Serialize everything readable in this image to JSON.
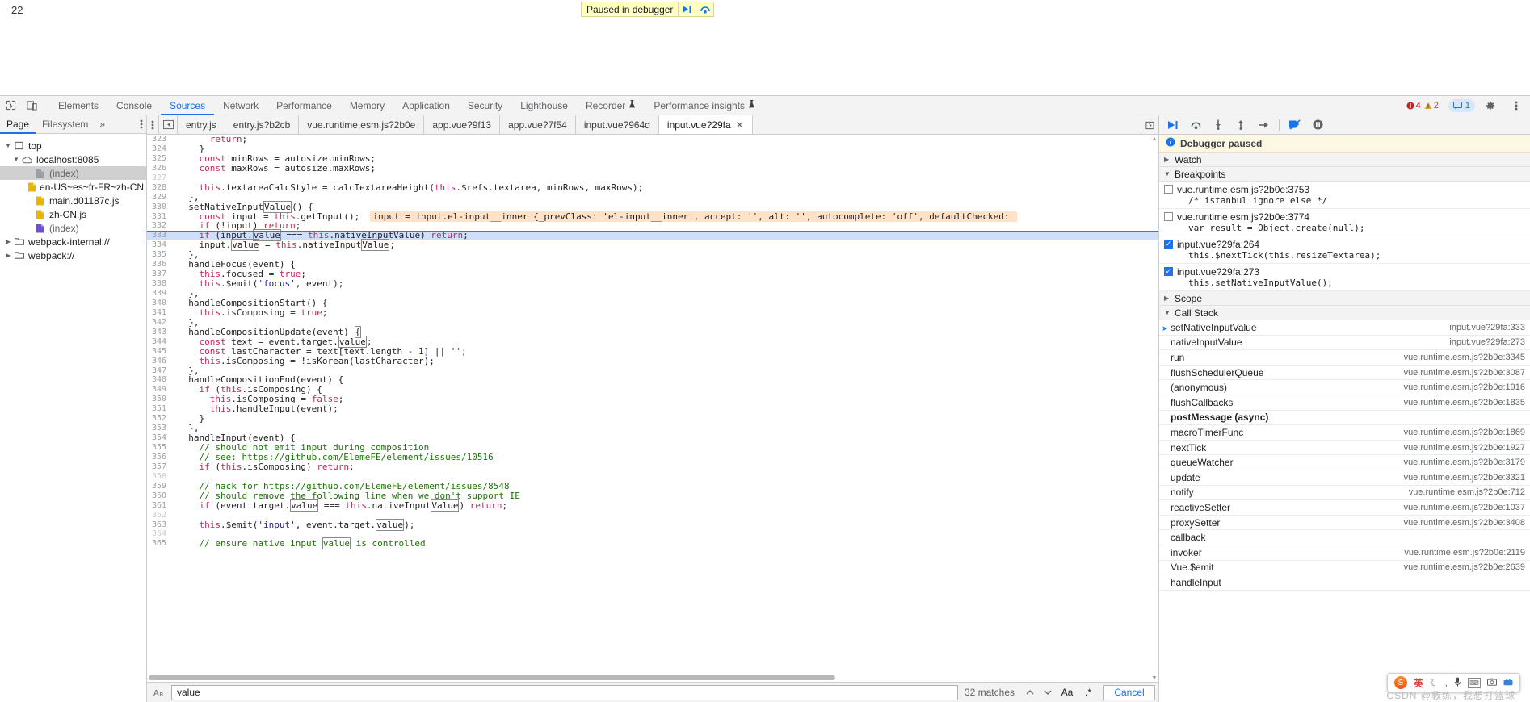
{
  "viewport": {
    "count_label": "22",
    "paused_banner": {
      "text": "Paused in debugger",
      "resume_icon": "resume-icon",
      "step_over_icon": "step-over-icon"
    }
  },
  "devtools": {
    "toolbar": {
      "inspect_icon": "inspect-element-icon",
      "device_toolbar_icon": "device-toolbar-icon",
      "panels": [
        {
          "label": "Elements",
          "active": false,
          "badge": ""
        },
        {
          "label": "Console",
          "active": false,
          "badge": ""
        },
        {
          "label": "Sources",
          "active": true,
          "badge": ""
        },
        {
          "label": "Network",
          "active": false,
          "badge": ""
        },
        {
          "label": "Performance",
          "active": false,
          "badge": ""
        },
        {
          "label": "Memory",
          "active": false,
          "badge": ""
        },
        {
          "label": "Application",
          "active": false,
          "badge": ""
        },
        {
          "label": "Security",
          "active": false,
          "badge": ""
        },
        {
          "label": "Lighthouse",
          "active": false,
          "badge": ""
        },
        {
          "label": "Recorder",
          "active": false,
          "badge": "experiment-icon"
        },
        {
          "label": "Performance insights",
          "active": false,
          "badge": "experiment-icon"
        }
      ],
      "errors_count": "4",
      "warnings_count": "2",
      "messages_count": "1",
      "settings_icon": "gear-icon",
      "more_icon": "kebab-menu-icon"
    },
    "navigator": {
      "tabs": [
        {
          "label": "Page",
          "active": true
        },
        {
          "label": "Filesystem",
          "active": false
        }
      ],
      "more_tabs_icon": "chevron-double-right-icon",
      "kebab_icon": "kebab-menu-icon",
      "tree": [
        {
          "label": "top",
          "depth": 0,
          "icon": "frame-icon",
          "expanded": true,
          "selected": false
        },
        {
          "label": "localhost:8085",
          "depth": 1,
          "icon": "cloud-icon",
          "expanded": true,
          "selected": false
        },
        {
          "label": "(index)",
          "depth": 2,
          "icon": "document-icon",
          "expanded": null,
          "selected": true
        },
        {
          "label": "en-US~es~fr-FR~zh-CN.js",
          "depth": 2,
          "icon": "script-icon",
          "expanded": null,
          "selected": false
        },
        {
          "label": "main.d01187c.js",
          "depth": 2,
          "icon": "script-icon",
          "expanded": null,
          "selected": false
        },
        {
          "label": "zh-CN.js",
          "depth": 2,
          "icon": "script-icon",
          "expanded": null,
          "selected": false
        },
        {
          "label": "(index)",
          "depth": 2,
          "icon": "document-purple-icon",
          "expanded": null,
          "selected": false
        },
        {
          "label": "webpack-internal://",
          "depth": 0,
          "icon": "folder-icon",
          "expanded": false,
          "selected": false
        },
        {
          "label": "webpack://",
          "depth": 0,
          "icon": "folder-icon",
          "expanded": false,
          "selected": false
        }
      ]
    },
    "file_tabs": {
      "kebab_icon": "kebab-menu-icon",
      "collapse_icon": "collapse-sidebar-icon",
      "more_icon": "more-tabs-icon",
      "items": [
        {
          "label": "entry.js",
          "active": false,
          "closable": false
        },
        {
          "label": "entry.js?b2cb",
          "active": false,
          "closable": false
        },
        {
          "label": "vue.runtime.esm.js?2b0e",
          "active": false,
          "closable": false
        },
        {
          "label": "app.vue?9f13",
          "active": false,
          "closable": false
        },
        {
          "label": "app.vue?7f54",
          "active": false,
          "closable": false
        },
        {
          "label": "input.vue?964d",
          "active": false,
          "closable": false
        },
        {
          "label": "input.vue?29fa",
          "active": true,
          "closable": true,
          "close_label": "✕"
        }
      ]
    },
    "editor": {
      "first_line": 323,
      "highlighted_line": 333,
      "inline_hint": "input = input.el-input__inner {_prevClass: 'el-input__inner', accept: '', alt: '', autocomplete: 'off', defaultChecked: ",
      "lines": [
        {
          "n": 323,
          "text": "      return;"
        },
        {
          "n": 324,
          "text": "    }"
        },
        {
          "n": 325,
          "text": "    const minRows = autosize.minRows;"
        },
        {
          "n": 326,
          "text": "    const maxRows = autosize.maxRows;"
        },
        {
          "n": 327,
          "text": ""
        },
        {
          "n": 328,
          "text": "    this.textareaCalcStyle = calcTextareaHeight(this.$refs.textarea, minRows, maxRows);"
        },
        {
          "n": 329,
          "text": "  },"
        },
        {
          "n": 330,
          "text": "  setNativeInputValue() {"
        },
        {
          "n": 331,
          "text": "    const input = this.getInput();"
        },
        {
          "n": 332,
          "text": "    if (!input) return;"
        },
        {
          "n": 333,
          "text": "    if (input.value === this.nativeInputValue) return;"
        },
        {
          "n": 334,
          "text": "    input.value = this.nativeInputValue;"
        },
        {
          "n": 335,
          "text": "  },"
        },
        {
          "n": 336,
          "text": "  handleFocus(event) {"
        },
        {
          "n": 337,
          "text": "    this.focused = true;"
        },
        {
          "n": 338,
          "text": "    this.$emit('focus', event);"
        },
        {
          "n": 339,
          "text": "  },"
        },
        {
          "n": 340,
          "text": "  handleCompositionStart() {"
        },
        {
          "n": 341,
          "text": "    this.isComposing = true;"
        },
        {
          "n": 342,
          "text": "  },"
        },
        {
          "n": 343,
          "text": "  handleCompositionUpdate(event) {"
        },
        {
          "n": 344,
          "text": "    const text = event.target.value;"
        },
        {
          "n": 345,
          "text": "    const lastCharacter = text[text.length - 1] || '';"
        },
        {
          "n": 346,
          "text": "    this.isComposing = !isKorean(lastCharacter);"
        },
        {
          "n": 347,
          "text": "  },"
        },
        {
          "n": 348,
          "text": "  handleCompositionEnd(event) {"
        },
        {
          "n": 349,
          "text": "    if (this.isComposing) {"
        },
        {
          "n": 350,
          "text": "      this.isComposing = false;"
        },
        {
          "n": 351,
          "text": "      this.handleInput(event);"
        },
        {
          "n": 352,
          "text": "    }"
        },
        {
          "n": 353,
          "text": "  },"
        },
        {
          "n": 354,
          "text": "  handleInput(event) {"
        },
        {
          "n": 355,
          "text": "    // should not emit input during composition"
        },
        {
          "n": 356,
          "text": "    // see: https://github.com/ElemeFE/element/issues/10516"
        },
        {
          "n": 357,
          "text": "    if (this.isComposing) return;"
        },
        {
          "n": 358,
          "text": ""
        },
        {
          "n": 359,
          "text": "    // hack for https://github.com/ElemeFE/element/issues/8548"
        },
        {
          "n": 360,
          "text": "    // should remove the following line when we don't support IE"
        },
        {
          "n": 361,
          "text": "    if (event.target.value === this.nativeInputValue) return;"
        },
        {
          "n": 362,
          "text": ""
        },
        {
          "n": 363,
          "text": "    this.$emit('input', event.target.value);"
        },
        {
          "n": 364,
          "text": ""
        },
        {
          "n": 365,
          "text": "    // ensure native input value is controlled"
        }
      ]
    },
    "search": {
      "mode_icon": "case-search-icon",
      "value": "value",
      "placeholder": "Find",
      "matches": "32 matches",
      "prev_icon": "chevron-up-icon",
      "next_icon": "chevron-down-icon",
      "match_case_label": "Aa",
      "regex_label": ".*",
      "cancel_label": "Cancel"
    },
    "debugger": {
      "toolbar": {
        "resume_icon": "resume-script-icon",
        "step_over_icon": "step-over-icon",
        "step_into_icon": "step-into-icon",
        "step_out_icon": "step-out-icon",
        "step_icon": "step-icon",
        "deactivate_breakpoints_icon": "deactivate-breakpoints-icon",
        "pause_on_exceptions_icon": "pause-on-exceptions-icon"
      },
      "status": {
        "icon": "info-icon",
        "text": "Debugger paused"
      },
      "sections": [
        {
          "title": "Watch",
          "expanded": false
        },
        {
          "title": "Breakpoints",
          "expanded": true
        },
        {
          "title": "Scope",
          "expanded": false
        },
        {
          "title": "Call Stack",
          "expanded": true
        }
      ],
      "breakpoints": [
        {
          "checked": false,
          "location": "vue.runtime.esm.js?2b0e:3753",
          "code": "/* istanbul ignore else */"
        },
        {
          "checked": false,
          "location": "vue.runtime.esm.js?2b0e:3774",
          "code": "var result = Object.create(null);"
        },
        {
          "checked": true,
          "location": "input.vue?29fa:264",
          "code": "this.$nextTick(this.resizeTextarea);"
        },
        {
          "checked": true,
          "location": "input.vue?29fa:273",
          "code": "this.setNativeInputValue();"
        }
      ],
      "call_stack": [
        {
          "name": "setNativeInputValue",
          "location": "input.vue?29fa:333",
          "current": true,
          "async": false
        },
        {
          "name": "nativeInputValue",
          "location": "input.vue?29fa:273",
          "current": false,
          "async": false
        },
        {
          "name": "run",
          "location": "vue.runtime.esm.js?2b0e:3345",
          "current": false,
          "async": false
        },
        {
          "name": "flushSchedulerQueue",
          "location": "vue.runtime.esm.js?2b0e:3087",
          "current": false,
          "async": false
        },
        {
          "name": "(anonymous)",
          "location": "vue.runtime.esm.js?2b0e:1916",
          "current": false,
          "async": false
        },
        {
          "name": "flushCallbacks",
          "location": "vue.runtime.esm.js?2b0e:1835",
          "current": false,
          "async": false
        },
        {
          "name": "postMessage (async)",
          "location": "",
          "current": false,
          "async": true
        },
        {
          "name": "macroTimerFunc",
          "location": "vue.runtime.esm.js?2b0e:1869",
          "current": false,
          "async": false
        },
        {
          "name": "nextTick",
          "location": "vue.runtime.esm.js?2b0e:1927",
          "current": false,
          "async": false
        },
        {
          "name": "queueWatcher",
          "location": "vue.runtime.esm.js?2b0e:3179",
          "current": false,
          "async": false
        },
        {
          "name": "update",
          "location": "vue.runtime.esm.js?2b0e:3321",
          "current": false,
          "async": false
        },
        {
          "name": "notify",
          "location": "vue.runtime.esm.js?2b0e:712",
          "current": false,
          "async": false
        },
        {
          "name": "reactiveSetter",
          "location": "vue.runtime.esm.js?2b0e:1037",
          "current": false,
          "async": false
        },
        {
          "name": "proxySetter",
          "location": "vue.runtime.esm.js?2b0e:3408",
          "current": false,
          "async": false
        },
        {
          "name": "callback",
          "location": "",
          "current": false,
          "async": false
        },
        {
          "name": "invoker",
          "location": "vue.runtime.esm.js?2b0e:2119",
          "current": false,
          "async": false
        },
        {
          "name": "Vue.$emit",
          "location": "vue.runtime.esm.js?2b0e:2639",
          "current": false,
          "async": false
        },
        {
          "name": "handleInput",
          "location": "",
          "current": false,
          "async": false
        }
      ]
    }
  },
  "ime_toolbar": {
    "logo": "S",
    "lang_label": "英",
    "moon_icon": "moon-icon",
    "punct_icon": "punctuation-icon",
    "mic_icon": "microphone-icon",
    "keyboard_icon": "keyboard-icon",
    "screenshot_icon": "screenshot-icon",
    "toolbox_icon": "toolbox-icon"
  },
  "watermark": {
    "text": "CSDN @教练，我想打篮球",
    "faded": ""
  },
  "colors": {
    "accent": "#1a73e8",
    "highlight_line": "#cfdffa",
    "inline_hint_bg": "#ffe2c8",
    "paused_bg": "#ffffc2",
    "debugger_note_bg": "#fdf8e3"
  }
}
